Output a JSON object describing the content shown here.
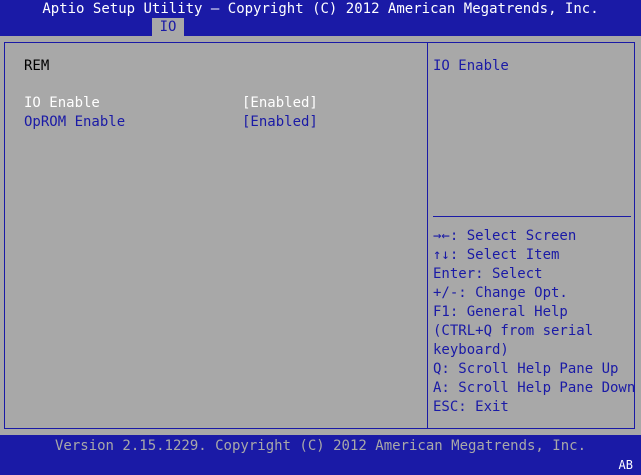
{
  "header": {
    "title": "Aptio Setup Utility – Copyright (C) 2012 American Megatrends, Inc.",
    "active_tab": "IO"
  },
  "main": {
    "section_heading": "REM",
    "settings": [
      {
        "label": "IO Enable",
        "value": "[Enabled]"
      },
      {
        "label": "OpROM Enable",
        "value": "[Enabled]"
      }
    ]
  },
  "help": {
    "description": "IO Enable",
    "keys": [
      "→←: Select Screen",
      "↑↓: Select Item",
      "Enter: Select",
      "+/-: Change Opt.",
      "F1: General Help",
      "(CTRL+Q from serial",
      "keyboard)",
      "Q: Scroll Help Pane Up",
      "A: Scroll Help Pane Down",
      "ESC: Exit"
    ]
  },
  "footer": {
    "version": "Version 2.15.1229. Copyright (C) 2012 American Megatrends, Inc.",
    "badge": "AB"
  },
  "colors": {
    "bios_blue": "#1a1aa6",
    "panel_gray": "#a8a8a8",
    "text_white": "#ffffff",
    "text_black": "#000000"
  }
}
